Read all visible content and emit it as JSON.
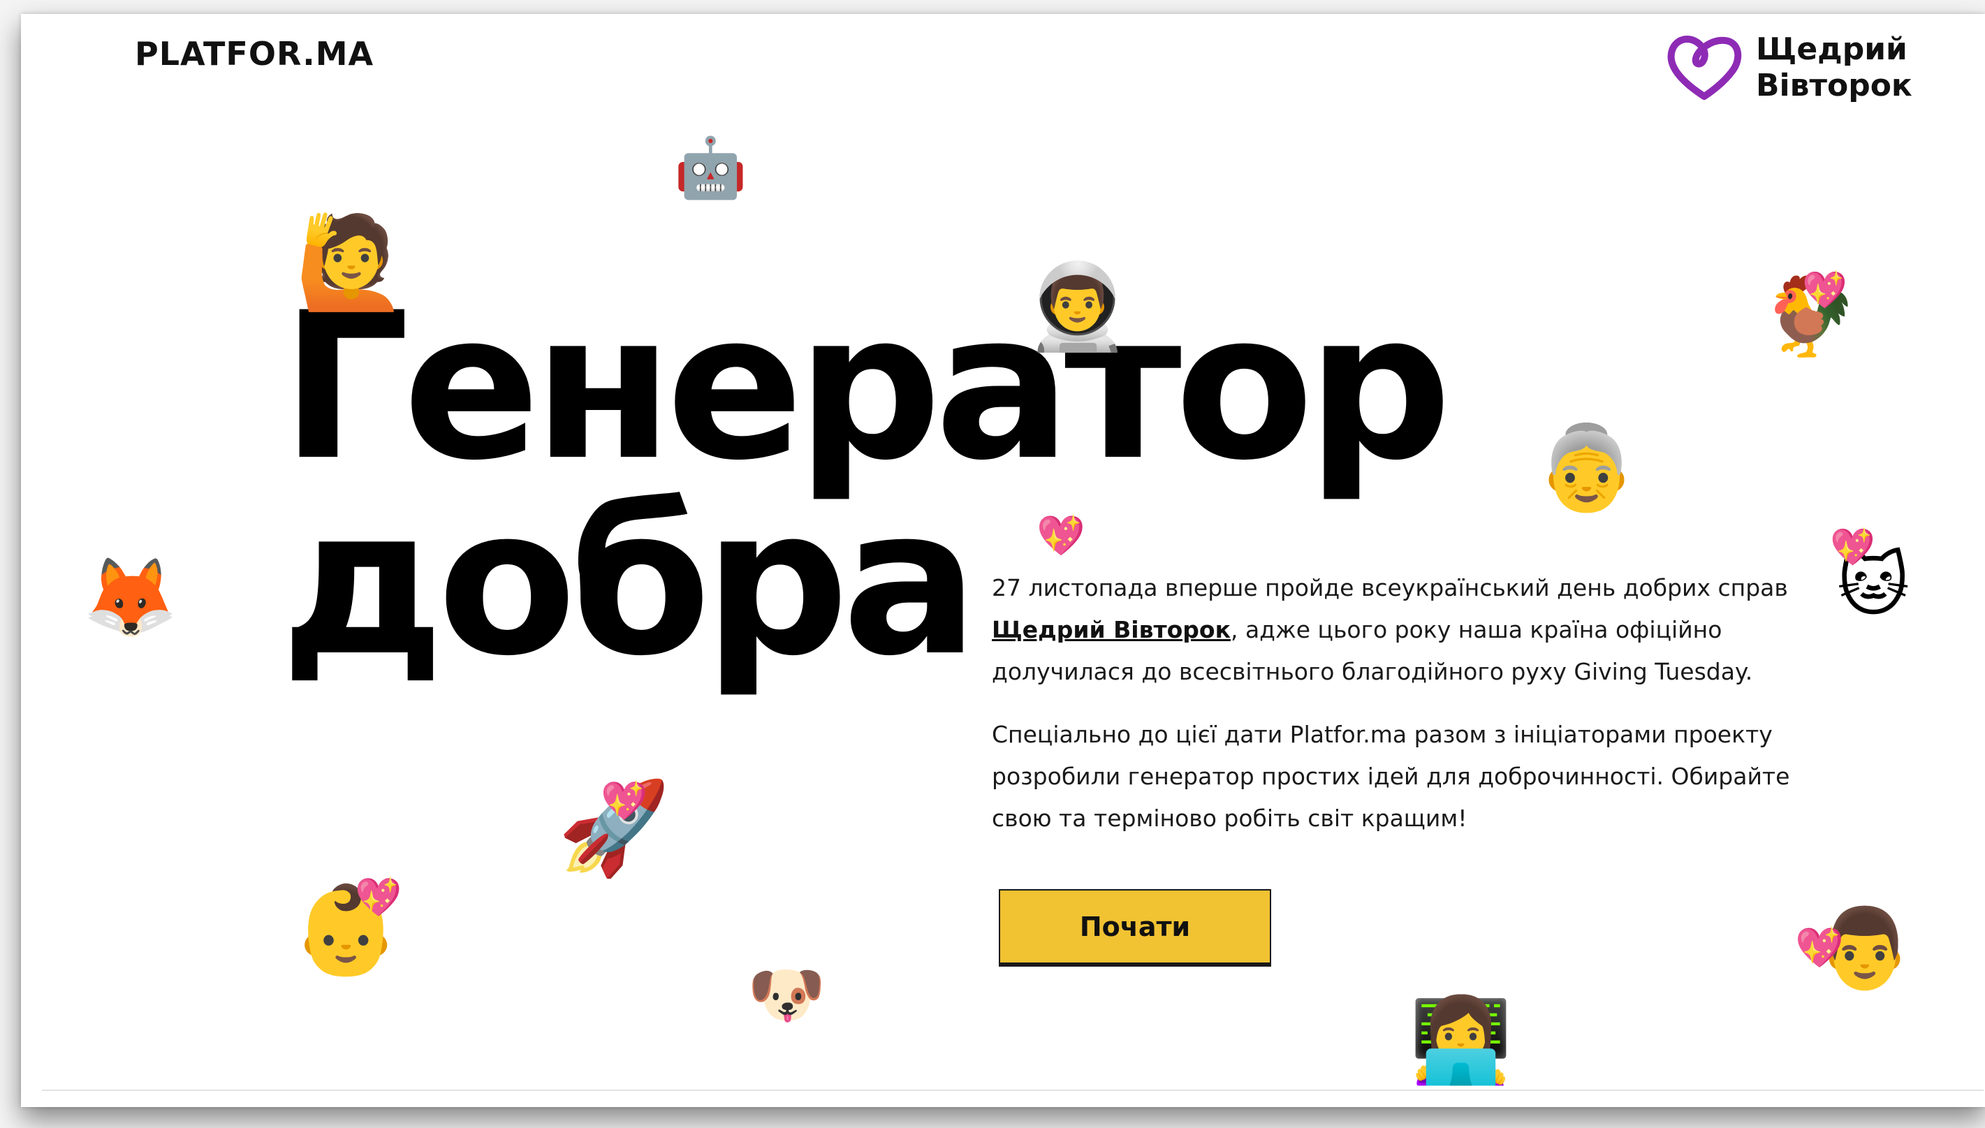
{
  "header": {
    "logo": "PLATFOR.MA",
    "partner": {
      "line1": "Щедрий",
      "line2": "Вівторок",
      "icon": "heart-outline-icon",
      "color": "#8e2bb5"
    }
  },
  "hero": {
    "title_line1": "Генератор",
    "title_line2": "добра"
  },
  "intro": {
    "p1_before": "27 листопада вперше пройде всеукраїнський день добрих справ ",
    "p1_link": "Щедрий Вівторок",
    "p1_after": ", адже цього року наша країна офіційно долучилася до всесвітнього благодійного руху Giving Tuesday.",
    "p2": "Спеціально до цієї дати Platfor.ma разом з ініціаторами проекту розробили генератор простих ідей для доброчинності. Обирайте свою та терміново робіть світ кращим!"
  },
  "cta": {
    "label": "Почати",
    "color": "#f1c232"
  },
  "emojis": {
    "robot": "🤖",
    "woman_raising_hand": "🙋",
    "astronaut": "👨‍🚀",
    "rooster": "🐓",
    "old_woman": "👵",
    "fox": "🦊",
    "cat": "🐱",
    "rocket": "🚀",
    "baby": "👶",
    "dog": "🐶",
    "technologist": "👩‍💻",
    "man": "👨",
    "heart": "💖"
  }
}
